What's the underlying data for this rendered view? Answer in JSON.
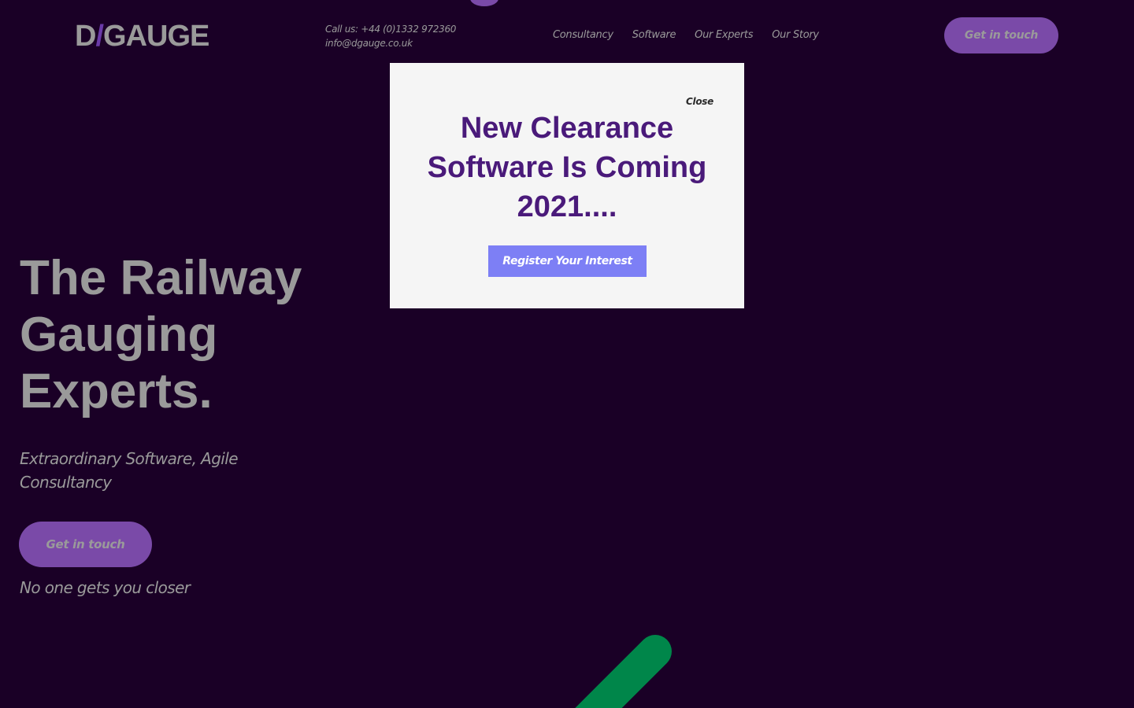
{
  "header": {
    "logo_left": "D",
    "logo_slash": "/",
    "logo_right": "GAUGE",
    "phone": "Call us: +44 (0)1332 972360",
    "email": "info@dgauge.co.uk",
    "nav": [
      "Consultancy",
      "Software",
      "Our Experts",
      "Our Story"
    ],
    "cta_label": "Get in touch"
  },
  "hero": {
    "title_lines": [
      "The Railway",
      "Gauging",
      "Experts."
    ],
    "subtitle": "Extraordinary Software, Agile Consultancy",
    "cta_label": "Get in touch",
    "tagline": "No one gets you closer"
  },
  "modal": {
    "close_label": "Close",
    "title_lines": [
      "New Clearance",
      "Software Is Coming",
      "2021...."
    ],
    "button_label": "Register Your Interest"
  },
  "colors": {
    "background": "#1a0026",
    "accent_purple": "#7a4aa8",
    "modal_title": "#4a1a7a",
    "modal_button": "#7d7ff5",
    "green_stroke": "#00864a"
  }
}
